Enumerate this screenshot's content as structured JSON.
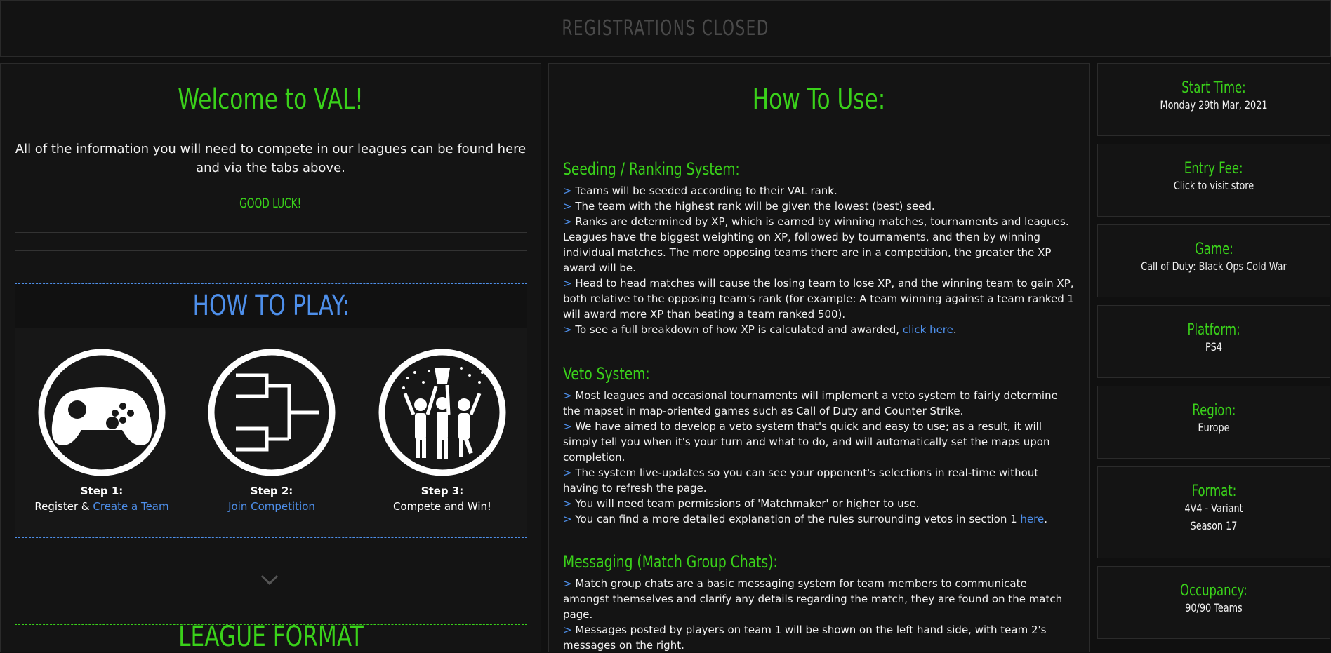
{
  "banner": {
    "text": "REGISTRATIONS CLOSED"
  },
  "welcome": {
    "title": "Welcome to VAL!",
    "text": "All of the information you will need to compete in our leagues can be found here and via the tabs above.",
    "good_luck": "GOOD LUCK!"
  },
  "how_to_play": {
    "title": "HOW TO PLAY:",
    "steps": [
      {
        "label": "Step 1:",
        "desc_prefix": "Register & ",
        "link": "Create a Team",
        "icon": "gamepad-icon"
      },
      {
        "label": "Step 2:",
        "desc_prefix": "",
        "link": "Join Competition",
        "icon": "bracket-icon"
      },
      {
        "label": "Step 3:",
        "desc_prefix": "Compete and Win!",
        "link": "",
        "icon": "trophy-celebration-icon"
      }
    ]
  },
  "league_format": {
    "title": "LEAGUE FORMAT"
  },
  "how_to_use": {
    "title": "How To Use:",
    "seeding": {
      "heading": "Seeding / Ranking System:",
      "items": [
        "Teams will be seeded according to their VAL rank.",
        "The team with the highest rank will be given the lowest (best) seed.",
        "Ranks are determined by XP, which is earned by winning matches, tournaments and leagues. Leagues have the biggest weighting on XP, followed by tournaments, and then by winning individual matches. The more opposing teams there are in a competition, the greater the XP award will be.",
        "Head to head matches will cause the losing team to lose XP, and the winning team to gain XP, both relative to the opposing team's rank (for example: A team winning against a team ranked 1 will award more XP than beating a team ranked 500)."
      ],
      "last_prefix": "To see a full breakdown of how XP is calculated and awarded, ",
      "last_link": "click here",
      "last_suffix": "."
    },
    "veto": {
      "heading": "Veto System:",
      "items": [
        "Most leagues and occasional tournaments will implement a veto system to fairly determine the mapset in map-oriented games such as Call of Duty and Counter Strike.",
        "We have aimed to develop a veto system that's quick and easy to use; as a result, it will simply tell you when it's your turn and what to do, and will automatically set the maps upon completion.",
        "The system live-updates so you can see your opponent's selections in real-time without having to refresh the page.",
        "You will need team permissions of 'Matchmaker' or higher to use."
      ],
      "last_prefix": "You can find a more detailed explanation of the rules surrounding vetos in section 1 ",
      "last_link": "here",
      "last_suffix": "."
    },
    "messaging": {
      "heading": "Messaging (Match Group Chats):",
      "items": [
        "Match group chats are a basic messaging system for team members to communicate amongst themselves and clarify any details regarding the match, they are found on the match page.",
        "Messages posted by players on team 1 will be shown on the left hand side, with team 2's messages on the right."
      ]
    }
  },
  "info": [
    {
      "label": "Start Time:",
      "values": [
        "Monday 29th Mar, 2021"
      ]
    },
    {
      "label": "Entry Fee:",
      "values": [
        "Click to visit store"
      ]
    },
    {
      "label": "Game:",
      "values": [
        "Call of Duty: Black Ops Cold War"
      ]
    },
    {
      "label": "Platform:",
      "values": [
        "PS4"
      ]
    },
    {
      "label": "Region:",
      "values": [
        "Europe"
      ]
    },
    {
      "label": "Format:",
      "values": [
        "4V4 - Variant",
        "Season 17"
      ]
    },
    {
      "label": "Occupancy:",
      "values": [
        "90/90 Teams"
      ]
    }
  ],
  "colors": {
    "accent_green": "#3ad11a",
    "accent_blue": "#4e8fea",
    "background": "#101010"
  }
}
